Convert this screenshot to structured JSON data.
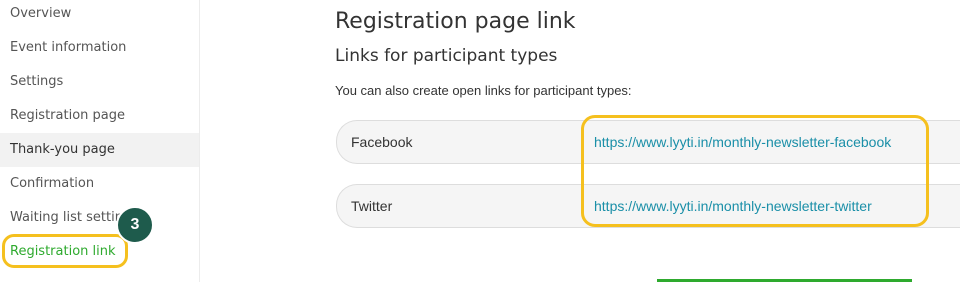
{
  "sidebar": {
    "items": [
      {
        "label": "Overview"
      },
      {
        "label": "Event information"
      },
      {
        "label": "Settings"
      },
      {
        "label": "Registration page"
      },
      {
        "label": "Thank-you page"
      },
      {
        "label": "Confirmation"
      },
      {
        "label": "Waiting list settings"
      },
      {
        "label": "Registration link"
      }
    ]
  },
  "step_badge": "3",
  "main": {
    "title": "Registration page link",
    "subtitle": "Links for participant types",
    "description": "You can also create open links for participant types:",
    "links": [
      {
        "type": "Facebook",
        "url": "https://www.lyyti.in/monthly-newsletter-facebook"
      },
      {
        "type": "Twitter",
        "url": "https://www.lyyti.in/monthly-newsletter-twitter"
      }
    ]
  },
  "colors": {
    "highlight": "#f5c01e",
    "badge": "#1e5b4c",
    "link": "#1a8fa8",
    "active_nav": "#2eaa2e"
  }
}
